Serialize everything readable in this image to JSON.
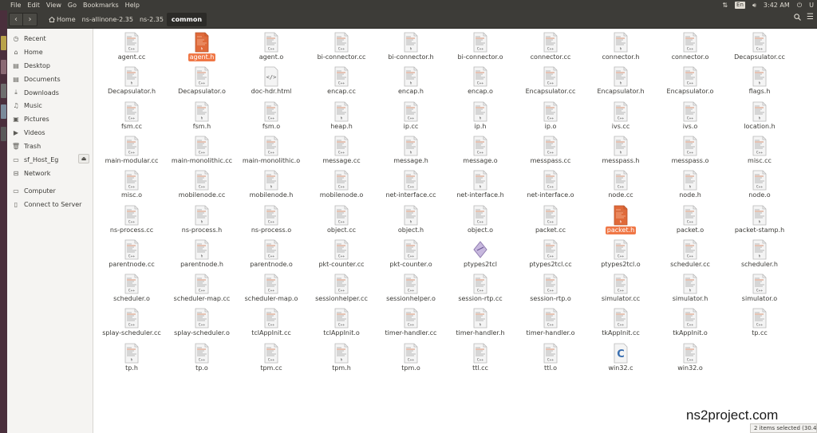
{
  "menubar": {
    "items": [
      "File",
      "Edit",
      "View",
      "Go",
      "Bookmarks",
      "Help"
    ],
    "lang": "En",
    "time": "3:42 AM",
    "user": "U"
  },
  "toolbar": {
    "breadcrumbs": [
      "Home",
      "ns-allinone-2.35",
      "ns-2.35",
      "common"
    ]
  },
  "sidebar": {
    "items": [
      {
        "label": "Recent",
        "icon": "clock-icon"
      },
      {
        "label": "Home",
        "icon": "home-icon"
      },
      {
        "label": "Desktop",
        "icon": "desktop-icon"
      },
      {
        "label": "Documents",
        "icon": "documents-icon"
      },
      {
        "label": "Downloads",
        "icon": "downloads-icon"
      },
      {
        "label": "Music",
        "icon": "music-icon"
      },
      {
        "label": "Pictures",
        "icon": "pictures-icon"
      },
      {
        "label": "Videos",
        "icon": "videos-icon"
      },
      {
        "label": "Trash",
        "icon": "trash-icon"
      },
      {
        "label": "sf_Host_Eg",
        "icon": "drive-icon"
      },
      {
        "label": "Network",
        "icon": "network-icon"
      },
      {
        "label": "Computer",
        "icon": "computer-icon"
      },
      {
        "label": "Connect to Server",
        "icon": "server-icon"
      }
    ]
  },
  "files": [
    {
      "name": "agent.cc",
      "type": "cc"
    },
    {
      "name": "agent.h",
      "type": "h",
      "selected": true
    },
    {
      "name": "agent.o",
      "type": "o"
    },
    {
      "name": "bi-connector.cc",
      "type": "cc"
    },
    {
      "name": "bi-connector.h",
      "type": "h"
    },
    {
      "name": "bi-connector.o",
      "type": "o"
    },
    {
      "name": "connector.cc",
      "type": "cc"
    },
    {
      "name": "connector.h",
      "type": "h"
    },
    {
      "name": "connector.o",
      "type": "o"
    },
    {
      "name": "Decapsulator.cc",
      "type": "cc"
    },
    {
      "name": "Decapsulator.h",
      "type": "h"
    },
    {
      "name": "Decapsulator.o",
      "type": "o"
    },
    {
      "name": "doc-hdr.html",
      "type": "html"
    },
    {
      "name": "encap.cc",
      "type": "cc"
    },
    {
      "name": "encap.h",
      "type": "h"
    },
    {
      "name": "encap.o",
      "type": "o"
    },
    {
      "name": "Encapsulator.cc",
      "type": "cc"
    },
    {
      "name": "Encapsulator.h",
      "type": "h"
    },
    {
      "name": "Encapsulator.o",
      "type": "o"
    },
    {
      "name": "flags.h",
      "type": "h"
    },
    {
      "name": "fsm.cc",
      "type": "cc"
    },
    {
      "name": "fsm.h",
      "type": "h"
    },
    {
      "name": "fsm.o",
      "type": "o"
    },
    {
      "name": "heap.h",
      "type": "h"
    },
    {
      "name": "ip.cc",
      "type": "cc"
    },
    {
      "name": "ip.h",
      "type": "h"
    },
    {
      "name": "ip.o",
      "type": "o"
    },
    {
      "name": "ivs.cc",
      "type": "cc"
    },
    {
      "name": "ivs.o",
      "type": "o"
    },
    {
      "name": "location.h",
      "type": "h"
    },
    {
      "name": "main-modular.cc",
      "type": "cc"
    },
    {
      "name": "main-monolithic.cc",
      "type": "cc"
    },
    {
      "name": "main-monolithic.o",
      "type": "o"
    },
    {
      "name": "message.cc",
      "type": "cc"
    },
    {
      "name": "message.h",
      "type": "h"
    },
    {
      "name": "message.o",
      "type": "o"
    },
    {
      "name": "messpass.cc",
      "type": "cc"
    },
    {
      "name": "messpass.h",
      "type": "h"
    },
    {
      "name": "messpass.o",
      "type": "o"
    },
    {
      "name": "misc.cc",
      "type": "cc"
    },
    {
      "name": "misc.o",
      "type": "o"
    },
    {
      "name": "mobilenode.cc",
      "type": "cc"
    },
    {
      "name": "mobilenode.h",
      "type": "h"
    },
    {
      "name": "mobilenode.o",
      "type": "o"
    },
    {
      "name": "net-interface.cc",
      "type": "cc"
    },
    {
      "name": "net-interface.h",
      "type": "h"
    },
    {
      "name": "net-interface.o",
      "type": "o"
    },
    {
      "name": "node.cc",
      "type": "cc"
    },
    {
      "name": "node.h",
      "type": "h"
    },
    {
      "name": "node.o",
      "type": "o"
    },
    {
      "name": "ns-process.cc",
      "type": "cc"
    },
    {
      "name": "ns-process.h",
      "type": "h"
    },
    {
      "name": "ns-process.o",
      "type": "o"
    },
    {
      "name": "object.cc",
      "type": "cc"
    },
    {
      "name": "object.h",
      "type": "h"
    },
    {
      "name": "object.o",
      "type": "o"
    },
    {
      "name": "packet.cc",
      "type": "cc"
    },
    {
      "name": "packet.h",
      "type": "h",
      "selected": true
    },
    {
      "name": "packet.o",
      "type": "o"
    },
    {
      "name": "packet-stamp.h",
      "type": "h"
    },
    {
      "name": "parentnode.cc",
      "type": "cc"
    },
    {
      "name": "parentnode.h",
      "type": "h"
    },
    {
      "name": "parentnode.o",
      "type": "o"
    },
    {
      "name": "pkt-counter.cc",
      "type": "cc"
    },
    {
      "name": "pkt-counter.o",
      "type": "o"
    },
    {
      "name": "ptypes2tcl",
      "type": "exec"
    },
    {
      "name": "ptypes2tcl.cc",
      "type": "cc"
    },
    {
      "name": "ptypes2tcl.o",
      "type": "o"
    },
    {
      "name": "scheduler.cc",
      "type": "cc"
    },
    {
      "name": "scheduler.h",
      "type": "h"
    },
    {
      "name": "scheduler.o",
      "type": "o"
    },
    {
      "name": "scheduler-map.cc",
      "type": "cc"
    },
    {
      "name": "scheduler-map.o",
      "type": "o"
    },
    {
      "name": "sessionhelper.cc",
      "type": "cc"
    },
    {
      "name": "sessionhelper.o",
      "type": "o"
    },
    {
      "name": "session-rtp.cc",
      "type": "cc"
    },
    {
      "name": "session-rtp.o",
      "type": "o"
    },
    {
      "name": "simulator.cc",
      "type": "cc"
    },
    {
      "name": "simulator.h",
      "type": "h"
    },
    {
      "name": "simulator.o",
      "type": "o"
    },
    {
      "name": "splay-scheduler.cc",
      "type": "cc"
    },
    {
      "name": "splay-scheduler.o",
      "type": "o"
    },
    {
      "name": "tclAppInit.cc",
      "type": "cc"
    },
    {
      "name": "tclAppInit.o",
      "type": "o"
    },
    {
      "name": "timer-handler.cc",
      "type": "cc"
    },
    {
      "name": "timer-handler.h",
      "type": "h"
    },
    {
      "name": "timer-handler.o",
      "type": "o"
    },
    {
      "name": "tkAppInit.cc",
      "type": "cc"
    },
    {
      "name": "tkAppInit.o",
      "type": "o"
    },
    {
      "name": "tp.cc",
      "type": "cc"
    },
    {
      "name": "tp.h",
      "type": "h"
    },
    {
      "name": "tp.o",
      "type": "o"
    },
    {
      "name": "tpm.cc",
      "type": "cc"
    },
    {
      "name": "tpm.h",
      "type": "h"
    },
    {
      "name": "tpm.o",
      "type": "o"
    },
    {
      "name": "ttl.cc",
      "type": "cc"
    },
    {
      "name": "ttl.o",
      "type": "o"
    },
    {
      "name": "win32.c",
      "type": "c"
    },
    {
      "name": "win32.o",
      "type": "o"
    }
  ],
  "status": "2 items selected (30.4 kB)",
  "watermark": "ns2project.com",
  "colors": {
    "accent": "#f07746",
    "toolbar": "#3d3c38",
    "sidebar": "#f5f4f2"
  }
}
